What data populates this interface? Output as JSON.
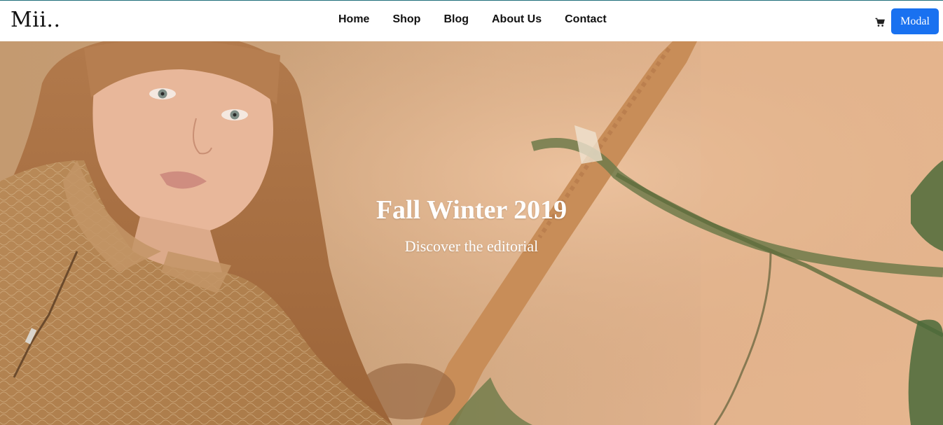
{
  "brand": {
    "logo_text": "Mii.."
  },
  "nav": {
    "items": [
      {
        "label": "Home"
      },
      {
        "label": "Shop"
      },
      {
        "label": "Blog"
      },
      {
        "label": "About Us"
      },
      {
        "label": "Contact"
      }
    ],
    "cart_icon": "shopping-cart-icon",
    "modal_button_label": "Modal",
    "modal_button_color": "#1971f0"
  },
  "hero": {
    "title": "Fall Winter 2019",
    "subtitle": "Discover the editorial",
    "image_subject": "hero-photo-woman-with-plants"
  }
}
